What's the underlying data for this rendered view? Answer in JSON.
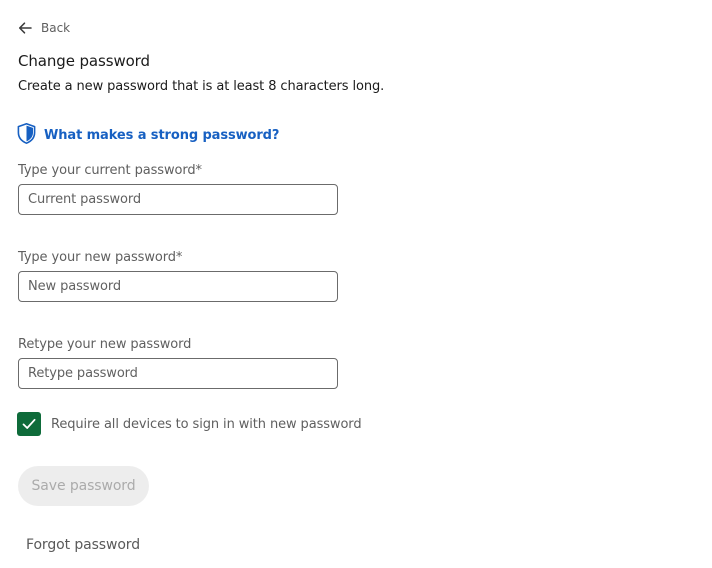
{
  "back": {
    "label": "Back",
    "icon": "arrow-left-icon"
  },
  "header": {
    "title": "Change password",
    "subtitle": "Create a new password that is at least 8 characters long."
  },
  "help": {
    "label": "What makes a strong password?",
    "icon": "shield-icon",
    "color": "#1760c2"
  },
  "fields": {
    "current": {
      "label": "Type your current password",
      "required_mark": "*",
      "placeholder": "Current password",
      "value": ""
    },
    "new": {
      "label": "Type your new password",
      "required_mark": "*",
      "placeholder": "New password",
      "value": ""
    },
    "retype": {
      "label": "Retype your new password",
      "placeholder": "Retype password",
      "value": ""
    }
  },
  "require_devices": {
    "label": "Require all devices to sign in with new password",
    "checked": true,
    "color": "#0e6b3a"
  },
  "save_button": {
    "label": "Save password",
    "disabled": true
  },
  "forgot_link": {
    "label": "Forgot password"
  }
}
